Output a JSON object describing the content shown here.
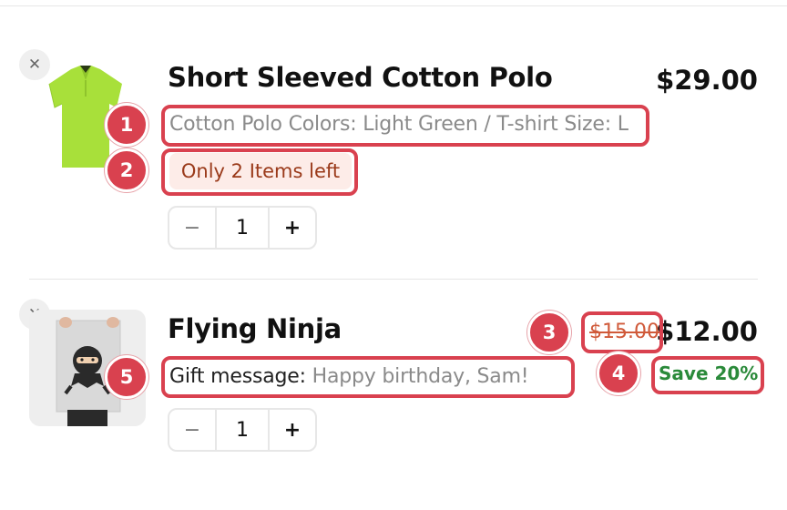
{
  "cart": {
    "items": [
      {
        "title": "Short Sleeved Cotton Polo",
        "price": "$29.00",
        "variant_label": "Cotton Polo Colors: Light Green / T-shirt Size: L",
        "stock_note": "Only 2 Items left",
        "quantity": "1",
        "image_color": "#a8e03a"
      },
      {
        "title": "Flying Ninja",
        "old_price": "$15.00",
        "price": "$12.00",
        "save_label": "Save 20%",
        "gift_label": "Gift message:",
        "gift_value": "Happy birthday, Sam!",
        "quantity": "1"
      }
    ],
    "stepper": {
      "minus": "−",
      "plus": "+"
    },
    "remove_glyph": "✕"
  },
  "annotations": [
    "1",
    "2",
    "3",
    "4",
    "5"
  ],
  "colors": {
    "annotation": "#d9414f",
    "stock_bg": "#fdece8",
    "stock_text": "#9a3a1a",
    "save_green": "#2a8a3a",
    "old_price": "#d05a3a"
  }
}
